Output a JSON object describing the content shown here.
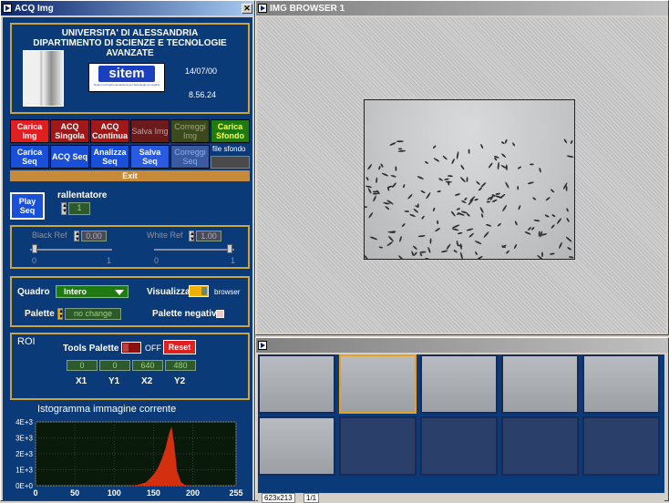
{
  "left_window": {
    "title": "ACQ Img",
    "header": {
      "line1": "UNIVERSITA' DI ALESSANDRIA",
      "line2": "DIPARTIMENTO DI SCIENZE E TECNOLOGIE AVANZATE",
      "date": "14/07/00",
      "time": "8.56.24",
      "logo_text": "sitem",
      "logo_sub": "Sistemi ed Instrumentazione per Tecnologie Innovative"
    },
    "buttons_row1": [
      "Carica Img",
      "ACQ Singola",
      "ACQ Continua",
      "Salva Img",
      "Correggi Img",
      "Carica Sfondo"
    ],
    "buttons_row2": [
      "Carica Seq",
      "ACQ Seq",
      "Analizza Seq",
      "Salva Seq",
      "Correggi Seq"
    ],
    "file_sfondo_label": "file sfondo",
    "exit_label": "Exit",
    "play_seq": "Play Seq",
    "rallentatore_label": "rallentatore",
    "rallentatore_value": "1",
    "black_ref_label": "Black Ref",
    "black_ref_value": "0.00",
    "white_ref_label": "White Ref",
    "white_ref_value": "1.00",
    "slider_min": "0",
    "slider_max": "1",
    "quadro_label": "Quadro",
    "quadro_value": "Intero",
    "visualizza_label": "Visualizza",
    "browser_label": "browser",
    "palette_label": "Palette",
    "palette_value": "no change",
    "palette_negativa_label": "Palette negativa",
    "roi_label": "ROI",
    "tools_palette_label": "Tools Palette",
    "tools_state": "OFF",
    "reset_label": "Reset",
    "roi_values": [
      "0",
      "0",
      "640",
      "480"
    ],
    "roi_names": [
      "X1",
      "Y1",
      "X2",
      "Y2"
    ],
    "hist_title": "Istogramma immagine corrente"
  },
  "chart_data": {
    "type": "area",
    "title": "Istogramma immagine corrente",
    "xlim": [
      0,
      255
    ],
    "ylim": [
      0,
      4000
    ],
    "xticks": [
      "0",
      "50",
      "100",
      "150",
      "200",
      "255"
    ],
    "yticks": [
      "0E+0",
      "1E+3",
      "2E+3",
      "3E+3",
      "4E+3"
    ],
    "color": "#d43010",
    "x": [
      0,
      120,
      130,
      140,
      145,
      150,
      155,
      160,
      165,
      170,
      173,
      176,
      180,
      185,
      190,
      200,
      255
    ],
    "values": [
      0,
      0,
      60,
      200,
      420,
      700,
      1050,
      1600,
      2300,
      3300,
      3700,
      2700,
      900,
      220,
      40,
      0,
      0
    ]
  },
  "img_browser": {
    "title": "IMG BROWSER 1"
  },
  "thumb_window": {
    "status_size": "623x213",
    "status_page": "1/1"
  }
}
